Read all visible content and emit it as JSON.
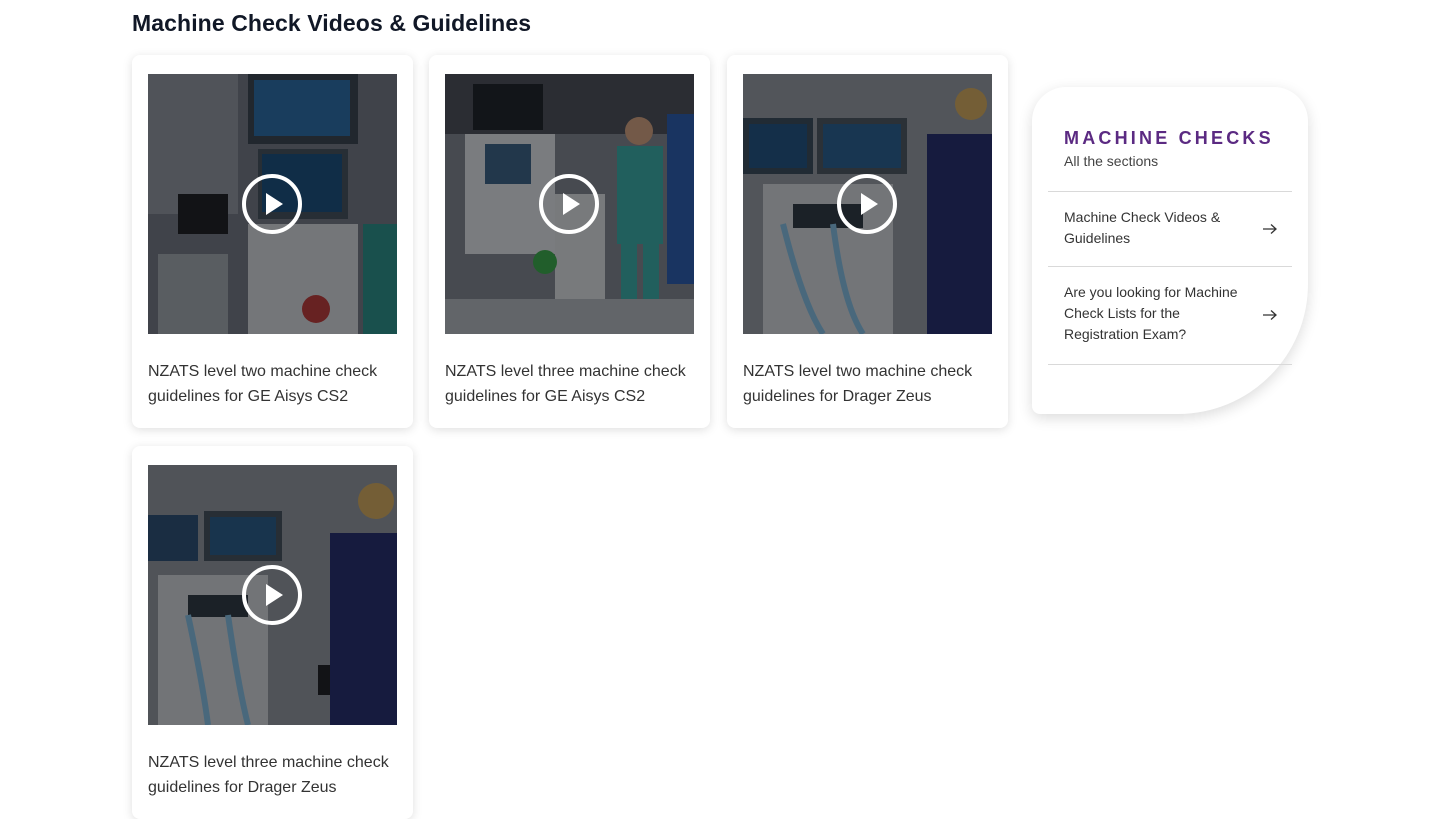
{
  "page": {
    "title": "Machine Check Videos & Guidelines"
  },
  "videos": [
    {
      "title": "NZATS level two machine check guidelines for GE Aisys CS2"
    },
    {
      "title": "NZATS level three machine check guidelines for GE Aisys CS2"
    },
    {
      "title": "NZATS level two machine check guidelines for Drager Zeus"
    },
    {
      "title": "NZATS level three machine check guidelines for Drager Zeus"
    }
  ],
  "sidebar": {
    "title": "MACHINE CHECKS",
    "subtitle": "All the sections",
    "items": [
      {
        "label": "Machine Check Videos & Guidelines",
        "icon": "arrow-right-icon"
      },
      {
        "label": "Are you looking for Machine Check Lists for the Registration Exam?",
        "icon": "arrow-right-icon"
      }
    ]
  },
  "colors": {
    "accent": "#5b2a82",
    "heading": "#111827",
    "text": "#333333"
  }
}
